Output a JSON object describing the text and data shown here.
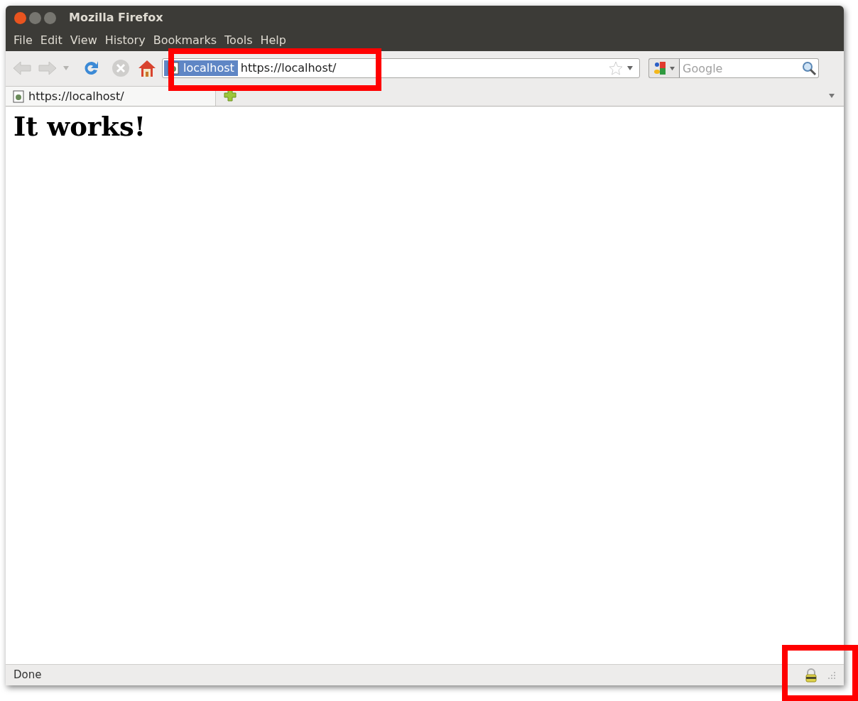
{
  "window": {
    "title": "Mozilla Firefox"
  },
  "menu": [
    "File",
    "Edit",
    "View",
    "History",
    "Bookmarks",
    "Tools",
    "Help"
  ],
  "toolbar": {
    "back_disabled": true,
    "forward_disabled": true
  },
  "address_bar": {
    "identity": "localhost",
    "value": "https://localhost/"
  },
  "search": {
    "placeholder": "Google"
  },
  "tabs": [
    {
      "label": "https://localhost/",
      "selected": true
    }
  ],
  "page": {
    "heading": "It works!"
  },
  "status_bar": {
    "text": "Done",
    "secure": true
  },
  "annotations": {
    "address_highlighted": true,
    "lock_highlighted": true
  }
}
